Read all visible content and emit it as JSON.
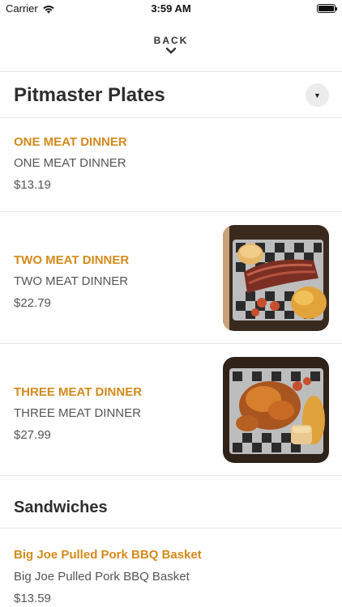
{
  "status_bar": {
    "carrier": "Carrier",
    "time": "3:59 AM"
  },
  "nav": {
    "back_label": "BACK"
  },
  "sections": [
    {
      "title": "Pitmaster Plates",
      "items": [
        {
          "name": "ONE MEAT DINNER",
          "description": "ONE MEAT DINNER",
          "price": "$13.19"
        },
        {
          "name": "TWO MEAT DINNER",
          "description": "TWO MEAT DINNER",
          "price": "$22.79"
        },
        {
          "name": "THREE MEAT DINNER",
          "description": "THREE MEAT DINNER",
          "price": "$27.99"
        }
      ]
    },
    {
      "title": "Sandwiches",
      "items": [
        {
          "name": "Big Joe Pulled Pork BBQ Basket",
          "description": "Big Joe Pulled Pork BBQ Basket",
          "price": "$13.59"
        }
      ]
    }
  ],
  "colors": {
    "accent": "#d48a1a",
    "text": "#555555",
    "divider": "#e6e6e6"
  }
}
